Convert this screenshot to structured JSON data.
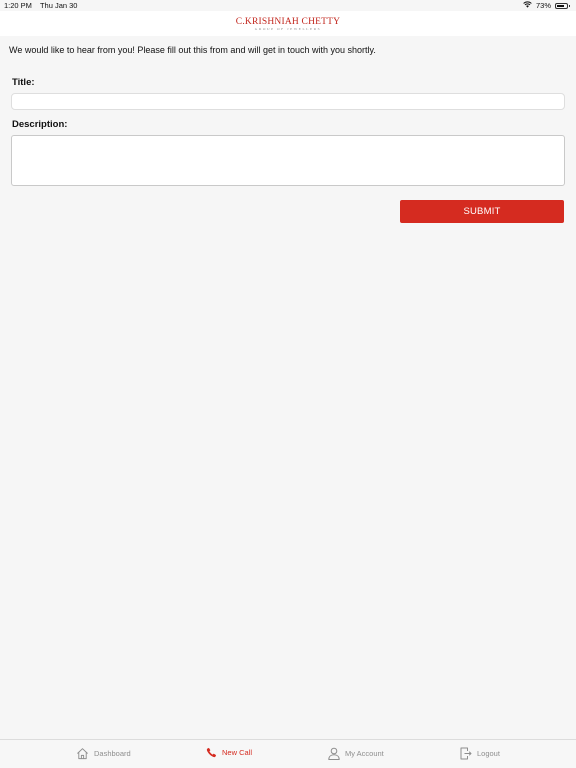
{
  "status_bar": {
    "time": "1:20 PM",
    "date": "Thu Jan 30",
    "battery": "73%",
    "battery_level": 0.73
  },
  "header": {
    "logo_text": "C.KRISHNIAH CHETTY",
    "logo_subtext": "GROUP OF JEWELLERS"
  },
  "form": {
    "intro": "We would like to hear from you! Please fill out this from and will get in touch with you shortly.",
    "title_label": "Title:",
    "title_value": "",
    "description_label": "Description:",
    "description_value": "",
    "submit_label": "SUBMIT"
  },
  "tab_bar": {
    "items": [
      {
        "label": "Dashboard",
        "icon": "home-icon",
        "active": false
      },
      {
        "label": "New Call",
        "icon": "phone-icon",
        "active": true
      },
      {
        "label": "My Account",
        "icon": "user-icon",
        "active": false
      },
      {
        "label": "Logout",
        "icon": "logout-icon",
        "active": false
      }
    ]
  },
  "colors": {
    "accent": "#d52b20",
    "background": "#f6f6f6",
    "inactive_tab": "#8e8e8e"
  }
}
